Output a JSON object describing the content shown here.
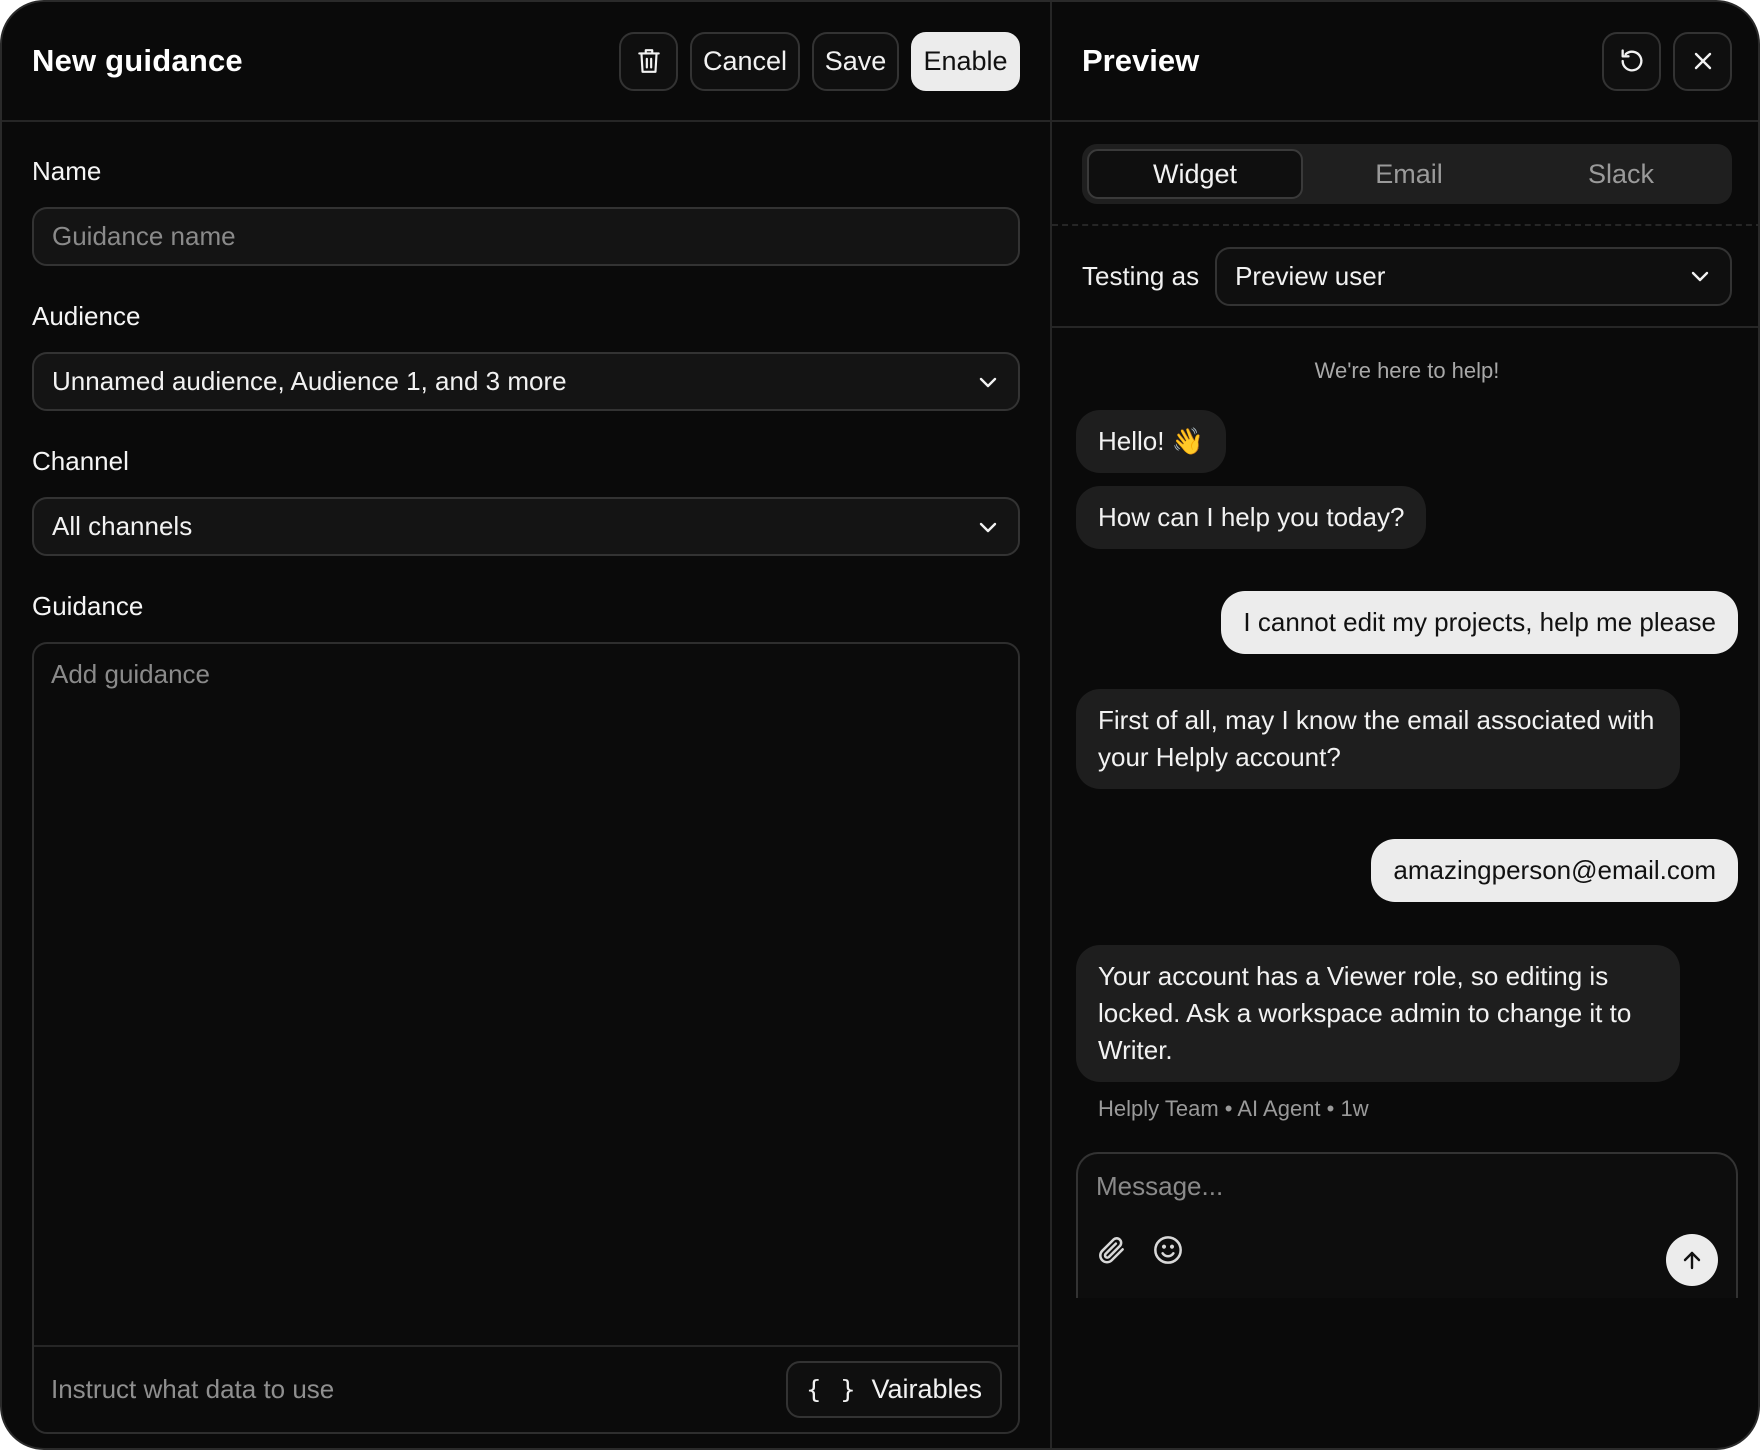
{
  "editor": {
    "title": "New guidance",
    "actions": {
      "cancel": "Cancel",
      "save": "Save",
      "enable": "Enable",
      "delete_icon": "trash-icon"
    },
    "fields": {
      "name": {
        "label": "Name",
        "placeholder": "Guidance name"
      },
      "audience": {
        "label": "Audience",
        "value": "Unnamed audience, Audience 1, and 3 more"
      },
      "channel": {
        "label": "Channel",
        "value": "All channels"
      },
      "guidance": {
        "label": "Guidance",
        "placeholder": "Add guidance",
        "hint": "Instruct what data to use",
        "variables_label": "Vairables",
        "variables_glyph": "{ }"
      }
    }
  },
  "preview": {
    "title": "Preview",
    "icons": {
      "reset": "refresh-icon",
      "close": "close-icon"
    },
    "tabs": [
      {
        "label": "Widget",
        "active": true
      },
      {
        "label": "Email",
        "active": false
      },
      {
        "label": "Slack",
        "active": false
      }
    ],
    "testing_as": {
      "label": "Testing as",
      "value": "Preview user"
    },
    "chat": {
      "intro": "We're here to help!",
      "messages": [
        {
          "from": "bot",
          "text": "Hello! 👋"
        },
        {
          "from": "bot",
          "text": "How can I help you today?"
        },
        {
          "from": "user",
          "text": "I cannot edit my projects, help me please"
        },
        {
          "from": "bot",
          "text": "First of all, may I know the email associated with your Helply account?"
        },
        {
          "from": "user",
          "text": "amazingperson@email.com"
        },
        {
          "from": "bot",
          "text": "Your account has a Viewer role, so editing is locked. Ask a workspace admin to change it to Writer."
        }
      ],
      "meta": "Helply Team • AI Agent • 1w"
    },
    "composer": {
      "placeholder": "Message...",
      "icons": [
        "paperclip-icon",
        "smiley-icon",
        "send-arrow-icon"
      ]
    }
  },
  "colors": {
    "background": "#0a0a0a",
    "surface": "#1e1e1e",
    "primary_button": "#ececec",
    "border": "#333333"
  }
}
